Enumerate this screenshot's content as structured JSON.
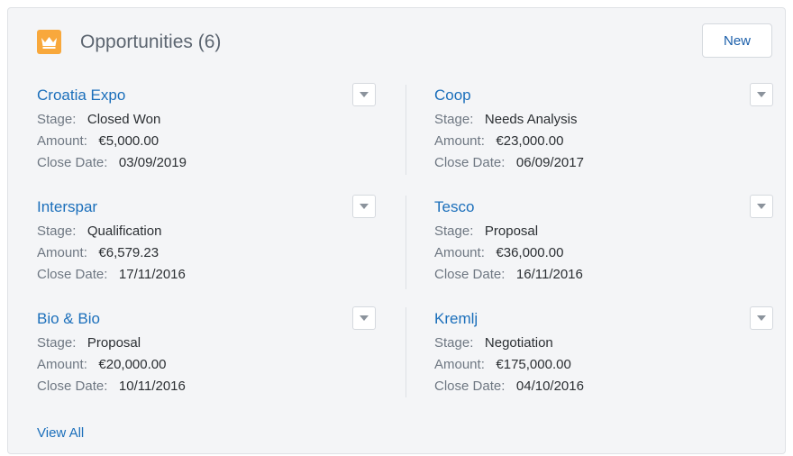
{
  "header": {
    "title": "Opportunities (6)",
    "new_label": "New",
    "icon": "crown-icon"
  },
  "labels": {
    "stage": "Stage:",
    "amount": "Amount:",
    "close_date": "Close Date:"
  },
  "opportunities": [
    {
      "name": "Croatia Expo",
      "stage": "Closed Won",
      "amount": "€5,000.00",
      "close_date": "03/09/2019"
    },
    {
      "name": "Coop",
      "stage": "Needs Analysis",
      "amount": "€23,000.00",
      "close_date": "06/09/2017"
    },
    {
      "name": "Interspar",
      "stage": "Qualification",
      "amount": "€6,579.23",
      "close_date": "17/11/2016"
    },
    {
      "name": "Tesco",
      "stage": "Proposal",
      "amount": "€36,000.00",
      "close_date": "16/11/2016"
    },
    {
      "name": "Bio & Bio",
      "stage": "Proposal",
      "amount": "€20,000.00",
      "close_date": "10/11/2016"
    },
    {
      "name": "Kremlj",
      "stage": "Negotiation",
      "amount": "€175,000.00",
      "close_date": "04/10/2016"
    }
  ],
  "footer": {
    "view_all_label": "View All"
  },
  "colors": {
    "link": "#1b6fbb",
    "crown_bg": "#f8a83c",
    "card_bg": "#f4f5f7"
  }
}
